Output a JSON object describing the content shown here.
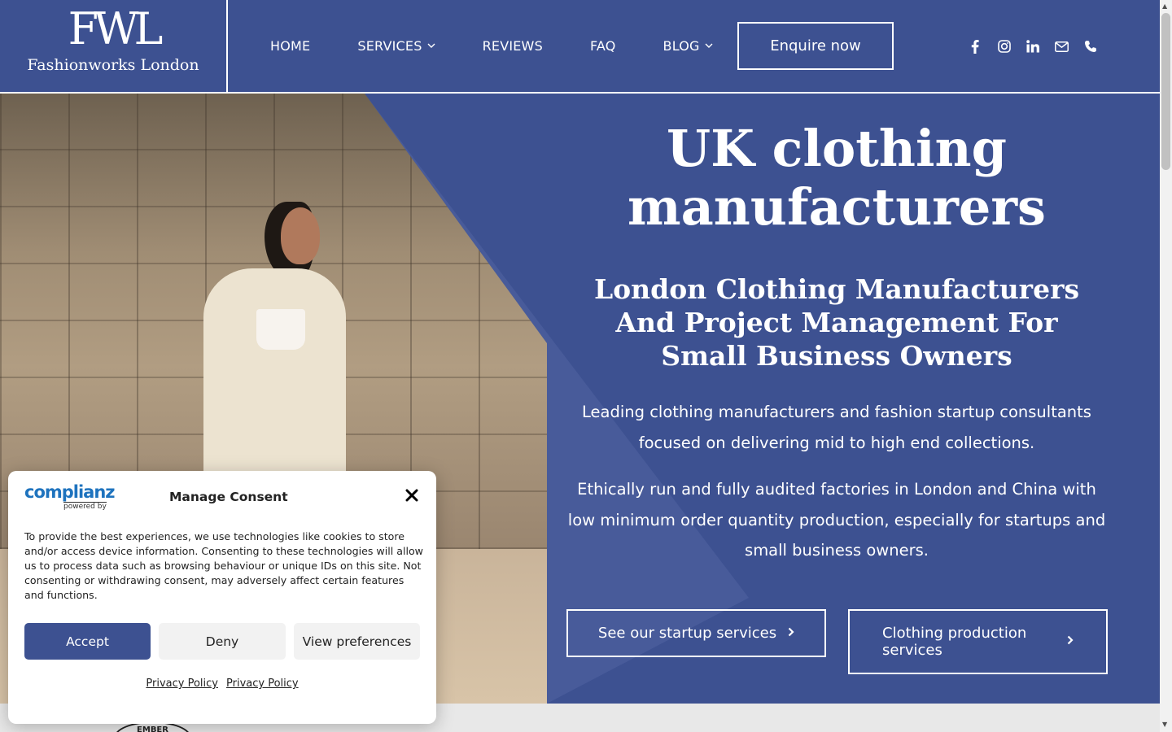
{
  "header": {
    "logo_mark": "FWL",
    "logo_name": "Fashionworks London",
    "nav": [
      {
        "label": "HOME"
      },
      {
        "label": "SERVICES",
        "has_dropdown": true
      },
      {
        "label": "REVIEWS"
      },
      {
        "label": "FAQ"
      },
      {
        "label": "BLOG",
        "has_dropdown": true
      }
    ],
    "cta_label": "Enquire now",
    "social_icons": [
      "facebook-icon",
      "instagram-icon",
      "linkedin-icon",
      "mail-icon",
      "phone-icon"
    ]
  },
  "hero": {
    "title_line1": "UK clothing",
    "title_line2": "manufacturers",
    "subtitle": "London Clothing Manufacturers And Project Management For Small Business Owners",
    "paragraph1": "Leading clothing manufacturers and fashion startup consultants focused on delivering mid to high end collections.",
    "paragraph2": "Ethically run and fully audited factories in London and China with low minimum order quantity production, especially for startups and small business owners.",
    "btn_startup": "See our startup services",
    "btn_production": "Clothing production services"
  },
  "badge_text": "EMBER",
  "consent": {
    "brand": "complianz",
    "powered_by": "powered by",
    "title": "Manage Consent",
    "text": "To provide the best experiences, we use technologies like cookies to store and/or access device information. Consenting to these technologies will allow us to process data such as browsing behaviour or unique IDs on this site. Not consenting or withdrawing consent, may adversely affect certain features and functions.",
    "accept": "Accept",
    "deny": "Deny",
    "preferences": "View preferences",
    "links": [
      "Privacy Policy",
      "Privacy Policy"
    ]
  },
  "colors": {
    "brand_blue": "#3d5191",
    "white": "#ffffff",
    "complianz_blue": "#1e73be"
  }
}
